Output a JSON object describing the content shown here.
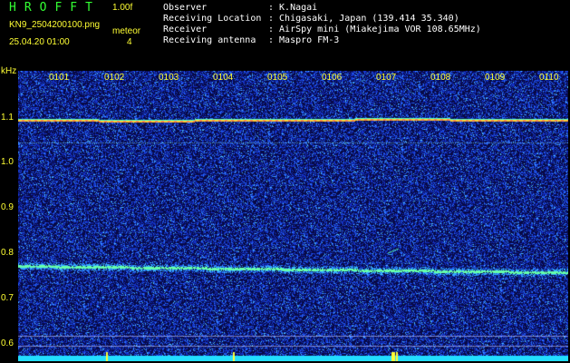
{
  "header": {
    "app_title": "HROFFT",
    "version": "1.00f",
    "file_name": "KN9_2504200100.png",
    "mode_label": "meteor",
    "mode_value": "4",
    "timestamp": "25.04.20 01:00",
    "info": [
      {
        "key": "Observer",
        "value": ": K.Nagai"
      },
      {
        "key": "Receiving Location",
        "value": ": Chigasaki, Japan (139.414 35.340)"
      },
      {
        "key": "Receiver",
        "value": ": AirSpy mini (Miakejima VOR 108.65MHz)"
      },
      {
        "key": "Receiving antenna",
        "value": ": Maspro FM-3"
      }
    ]
  },
  "axes": {
    "y_unit": "kHz",
    "y_ticks": [
      "1.1",
      "1.0",
      "0.9",
      "0.8",
      "0.7",
      "0.6"
    ],
    "x_ticks": [
      "0101",
      "0102",
      "0103",
      "0104",
      "0105",
      "0106",
      "0107",
      "0108",
      "0109",
      "0110"
    ]
  },
  "colors": {
    "background": "#0a0a5a",
    "noise": "#1e3cff",
    "carrier": "#ffcc33",
    "label": "#ffff33",
    "title": "#33ff33"
  }
}
